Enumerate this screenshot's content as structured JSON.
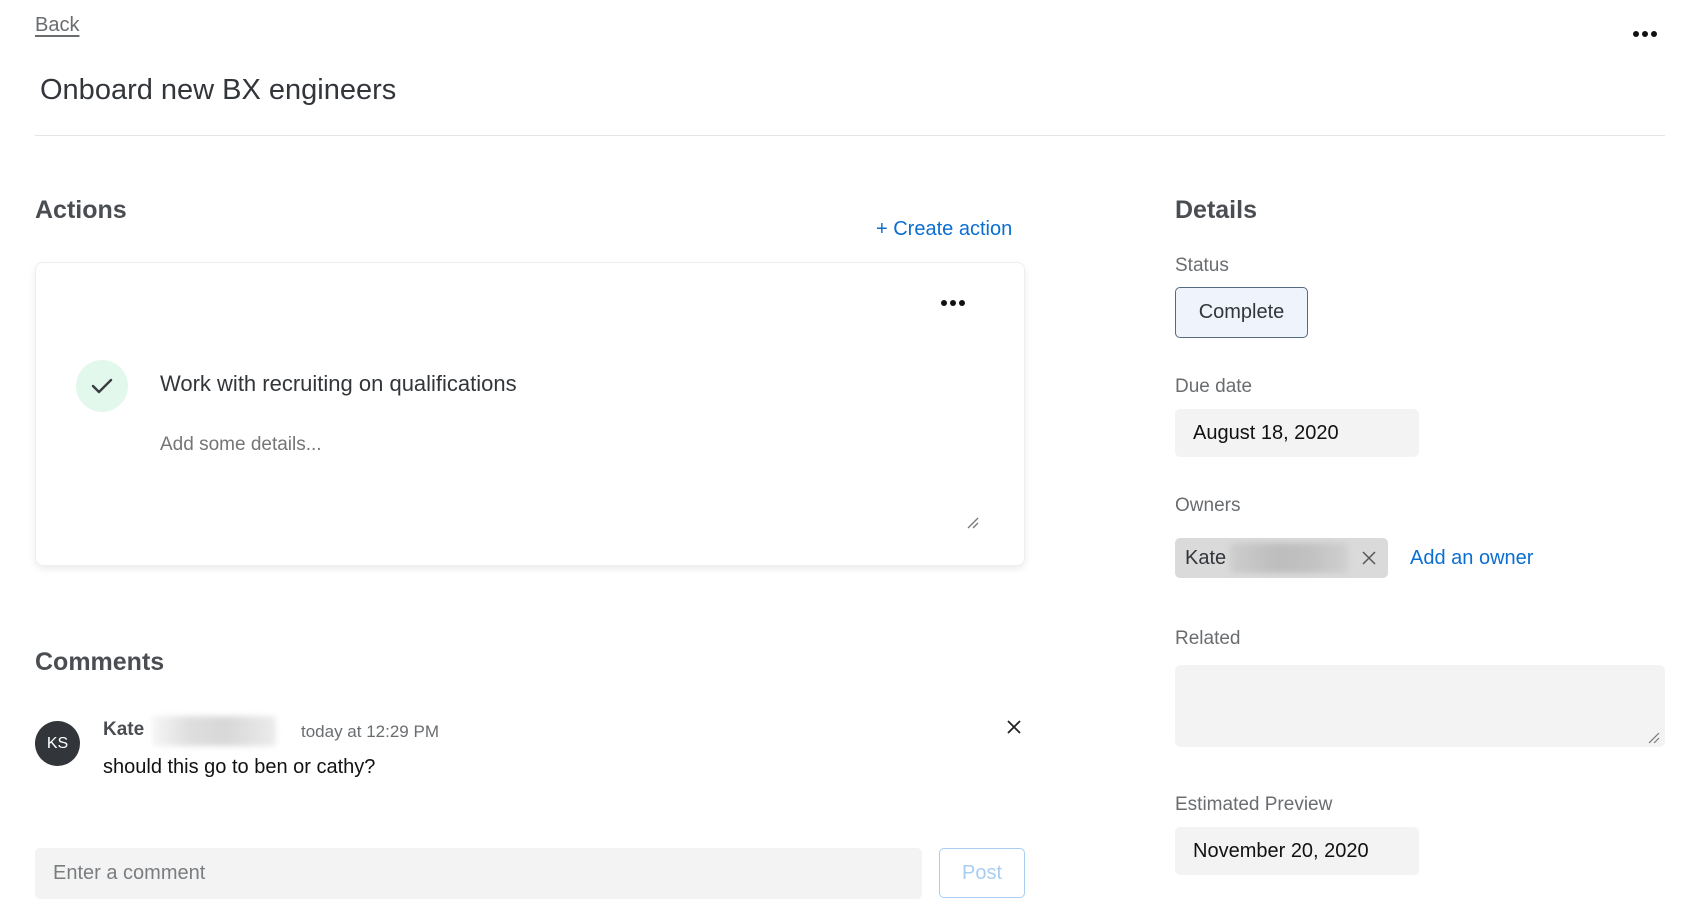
{
  "header": {
    "back_label": "Back",
    "title": "Onboard new BX engineers",
    "more_icon": "more-horizontal-icon"
  },
  "actions": {
    "heading": "Actions",
    "create_label": "+ Create action",
    "items": [
      {
        "title": "Work with recruiting on qualifications",
        "completed": true,
        "details_placeholder": "Add some details...",
        "details_value": "",
        "check_color": "#e3f8ec"
      }
    ]
  },
  "comments": {
    "heading": "Comments",
    "items": [
      {
        "initials": "KS",
        "author_first": "Kate",
        "author_last_redacted": true,
        "time": "today at 12:29 PM",
        "text": "should this go to ben or cathy?"
      }
    ],
    "input_placeholder": "Enter a comment",
    "input_value": "",
    "post_label": "Post"
  },
  "details": {
    "heading": "Details",
    "status_label": "Status",
    "status_value": "Complete",
    "due_date_label": "Due date",
    "due_date_value": "August 18, 2020",
    "owners_label": "Owners",
    "owners": [
      {
        "first_name": "Kate",
        "last_name_redacted": true
      }
    ],
    "add_owner_label": "Add an owner",
    "related_label": "Related",
    "related_value": "",
    "estimated_preview_label": "Estimated Preview",
    "estimated_preview_value": "November 20, 2020"
  },
  "colors": {
    "link": "#0b6ed0",
    "status_bg": "#eef3fc",
    "status_border": "#556b82",
    "post_disabled": "#a9cdf2",
    "field_bg": "#f3f3f3"
  }
}
